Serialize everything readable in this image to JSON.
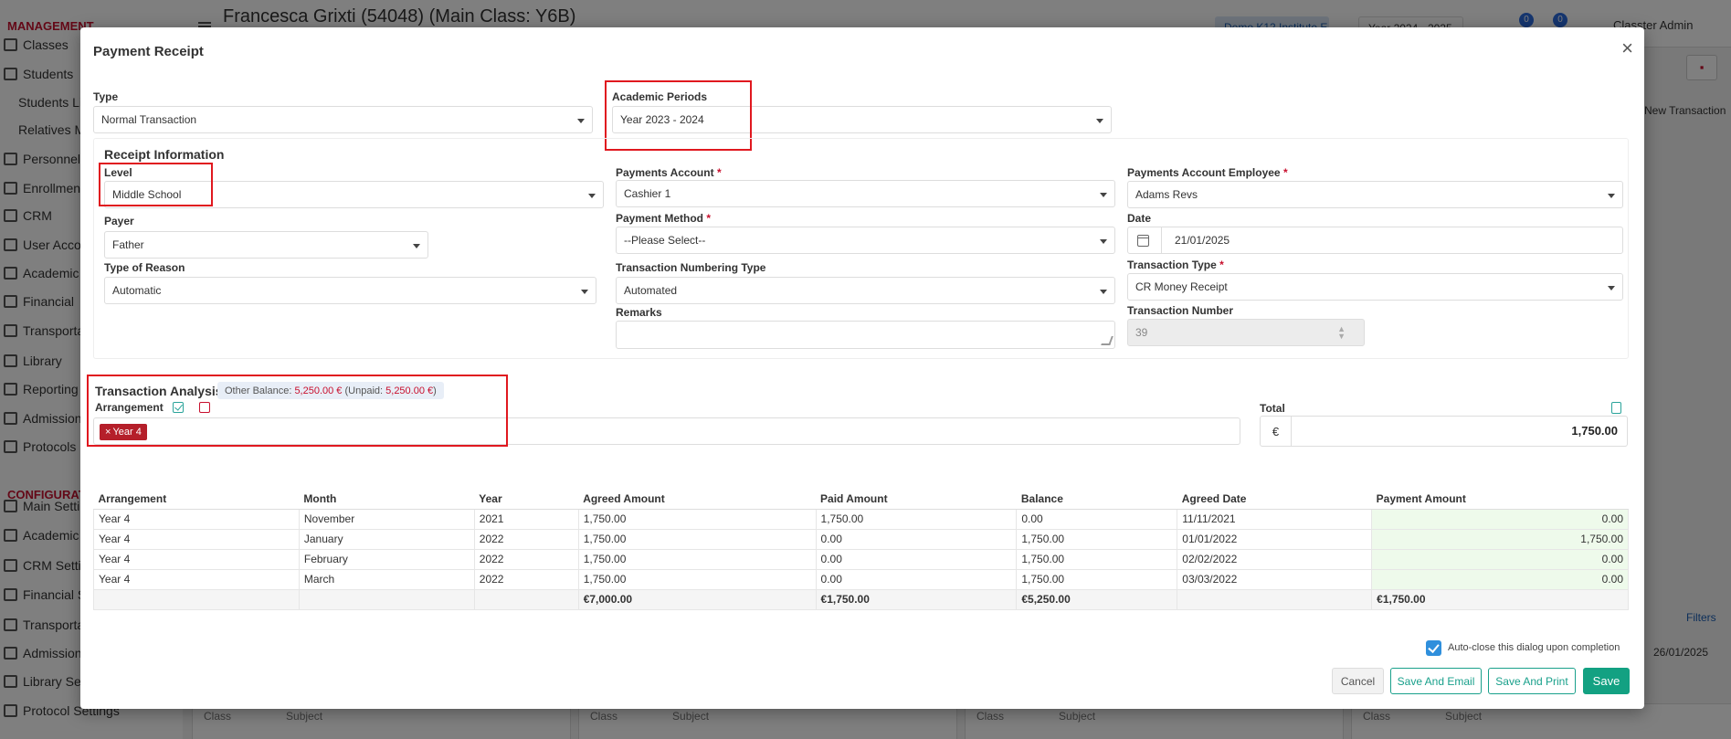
{
  "background": {
    "page_title": "Francesca Grixti (54048) (Main Class: Y6B)",
    "institute": "Demo K12 Institute E",
    "year": "Year 2024 - 2025",
    "user": "Classter Admin",
    "notification_count_1": "0",
    "notification_count_2": "0",
    "new_transaction": "New Transaction",
    "filters": "Filters",
    "date_right": "26/01/2025",
    "foot_labels": [
      "Class",
      "Subject"
    ],
    "sidebar": {
      "management_header": "MANAGEMENT",
      "configuration_header": "CONFIGURATION",
      "items": [
        "Classes",
        "Students",
        "Students List",
        "Relatives M",
        "Personnel a",
        "Enrollment",
        "CRM",
        "User Accou",
        "Academic T",
        "Financial",
        "Transporta",
        "Library",
        "Reporting",
        "Admission",
        "Protocols",
        "Main Setting",
        "Academic S",
        "CRM Setting",
        "Financial Se",
        "Transporta",
        "Admission",
        "Library Setti",
        "Protocol Settings"
      ]
    }
  },
  "modal": {
    "title": "Payment Receipt",
    "type": {
      "label": "Type",
      "value": "Normal Transaction"
    },
    "academic_periods": {
      "label": "Academic Periods",
      "value": "Year 2023 - 2024"
    },
    "receipt_info": {
      "title": "Receipt Information",
      "level": {
        "label": "Level",
        "value": "Middle School"
      },
      "payer": {
        "label": "Payer",
        "value": "Father"
      },
      "type_of_reason": {
        "label": "Type of Reason",
        "value": "Automatic"
      },
      "payments_account": {
        "label": "Payments Account",
        "value": "Cashier 1"
      },
      "payment_method": {
        "label": "Payment Method",
        "value": "--Please Select--"
      },
      "transaction_numbering_type": {
        "label": "Transaction Numbering Type",
        "value": "Automated"
      },
      "remarks": {
        "label": "Remarks",
        "value": ""
      },
      "payments_account_employee": {
        "label": "Payments Account Employee",
        "value": "Adams Revs"
      },
      "date": {
        "label": "Date",
        "value": "21/01/2025"
      },
      "transaction_type": {
        "label": "Transaction Type",
        "value": "CR Money Receipt"
      },
      "transaction_number": {
        "label": "Transaction Number",
        "value": "39"
      },
      "required_mark": "*"
    },
    "transaction_analysis": {
      "title": "Transaction Analysis",
      "other_balance_label": "Other Balance:",
      "other_balance_value": "5,250.00 €",
      "unpaid_label": "(Unpaid:",
      "unpaid_value": "5,250.00 €",
      "unpaid_close": ")",
      "arrangement_label": "Arrangement",
      "tag": "Year 4",
      "tag_remove": "×",
      "total_label": "Total",
      "currency": "€",
      "total_value": "1,750.00"
    },
    "table": {
      "headers": [
        "Arrangement",
        "Month",
        "Year",
        "Agreed Amount",
        "Paid Amount",
        "Balance",
        "Agreed Date",
        "Payment Amount"
      ],
      "rows": [
        [
          "Year 4",
          "November",
          "2021",
          "1,750.00",
          "1,750.00",
          "0.00",
          "11/11/2021",
          "0.00"
        ],
        [
          "Year 4",
          "January",
          "2022",
          "1,750.00",
          "0.00",
          "1,750.00",
          "01/01/2022",
          "1,750.00"
        ],
        [
          "Year 4",
          "February",
          "2022",
          "1,750.00",
          "0.00",
          "1,750.00",
          "02/02/2022",
          "0.00"
        ],
        [
          "Year 4",
          "March",
          "2022",
          "1,750.00",
          "0.00",
          "1,750.00",
          "03/03/2022",
          "0.00"
        ]
      ],
      "footer": [
        "",
        "",
        "",
        "€7,000.00",
        "€1,750.00",
        "€5,250.00",
        "",
        "€1,750.00"
      ]
    },
    "auto_close_label": "Auto-close this dialog upon completion",
    "auto_close_checked": true,
    "buttons": {
      "cancel": "Cancel",
      "save_and_email": "Save And Email",
      "save_and_print": "Save And Print",
      "save": "Save"
    },
    "colors": {
      "accent": "#13a182",
      "required": "#c8102e",
      "highlight_box": "#e0181f"
    }
  }
}
